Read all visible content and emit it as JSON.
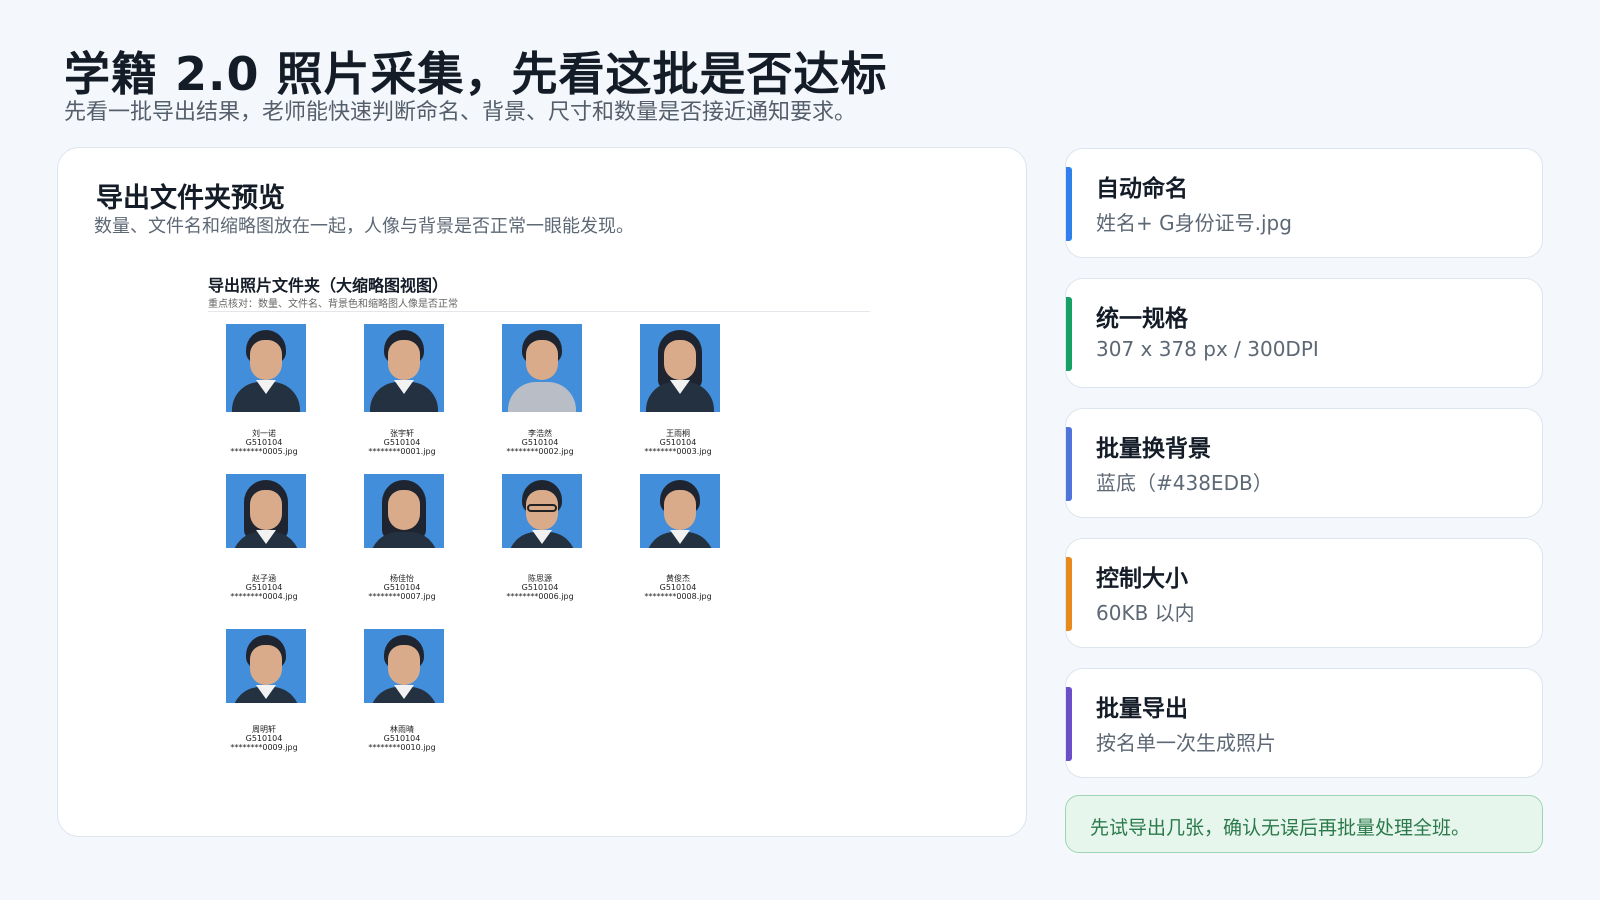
{
  "header": {
    "title": "学籍 2.0 照片采集，先看这批是否达标",
    "subtitle": "先看一批导出结果，老师能快速判断命名、背景、尺寸和数量是否接近通知要求。"
  },
  "preview": {
    "title": "导出文件夹预览",
    "subtitle": "数量、文件名和缩略图放在一起，人像与背景是否正常一眼能发现。",
    "folder_title": "导出照片文件夹（大缩略图视图）",
    "folder_hint": "重点核对：数量、文件名、背景色和缩略图人像是否正常",
    "background_color": "#438EDB",
    "photos": [
      {
        "name": "刘一诺",
        "code": "G510104",
        "file": "********0005.jpg"
      },
      {
        "name": "张宇轩",
        "code": "G510104",
        "file": "********0001.jpg"
      },
      {
        "name": "李浩然",
        "code": "G510104",
        "file": "********0002.jpg"
      },
      {
        "name": "王雨桐",
        "code": "G510104",
        "file": "********0003.jpg"
      },
      {
        "name": "赵子涵",
        "code": "G510104",
        "file": "********0004.jpg"
      },
      {
        "name": "杨佳怡",
        "code": "G510104",
        "file": "********0007.jpg"
      },
      {
        "name": "陈思源",
        "code": "G510104",
        "file": "********0006.jpg"
      },
      {
        "name": "黄俊杰",
        "code": "G510104",
        "file": "********0008.jpg"
      },
      {
        "name": "周明轩",
        "code": "G510104",
        "file": "********0009.jpg"
      },
      {
        "name": "林雨晴",
        "code": "G510104",
        "file": "********0010.jpg"
      }
    ]
  },
  "specs": [
    {
      "title": "自动命名",
      "value": "姓名+ G身份证号.jpg",
      "color": "#2f80ed"
    },
    {
      "title": "统一规格",
      "value": "307 x 378 px / 300DPI",
      "color": "#16a064"
    },
    {
      "title": "批量换背景",
      "value": "蓝底（#438EDB）",
      "color": "#4f74db"
    },
    {
      "title": "控制大小",
      "value": "60KB 以内",
      "color": "#e8891e"
    },
    {
      "title": "批量导出",
      "value": "按名单一次生成照片",
      "color": "#6a4fc9"
    }
  ],
  "note": {
    "text": "先试导出几张，确认无误后再批量处理全班。"
  }
}
